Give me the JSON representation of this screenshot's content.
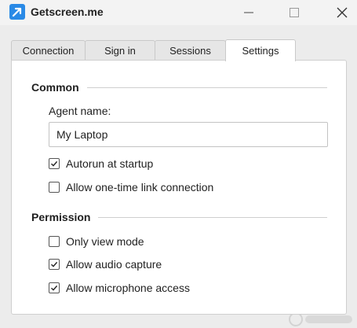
{
  "window": {
    "title": "Getscreen.me",
    "controls": [
      "minimize-icon",
      "maximize-icon",
      "close-icon"
    ]
  },
  "tabs": [
    {
      "label": "Connection",
      "active": false
    },
    {
      "label": "Sign in",
      "active": false
    },
    {
      "label": "Sessions",
      "active": false
    },
    {
      "label": "Settings",
      "active": true
    }
  ],
  "settings": {
    "common": {
      "title": "Common",
      "agent_name_label": "Agent name:",
      "agent_name_value": "My Laptop",
      "autorun": {
        "label": "Autorun at startup",
        "checked": true
      },
      "one_time_link": {
        "label": "Allow one-time link connection",
        "checked": false
      }
    },
    "permission": {
      "title": "Permission",
      "only_view": {
        "label": "Only view mode",
        "checked": false
      },
      "audio_capture": {
        "label": "Allow audio capture",
        "checked": true
      },
      "microphone": {
        "label": "Allow microphone access",
        "checked": true
      }
    }
  },
  "colors": {
    "brand": "#2a8ae6",
    "panel_bg": "#ffffff",
    "window_bg": "#ececec"
  }
}
